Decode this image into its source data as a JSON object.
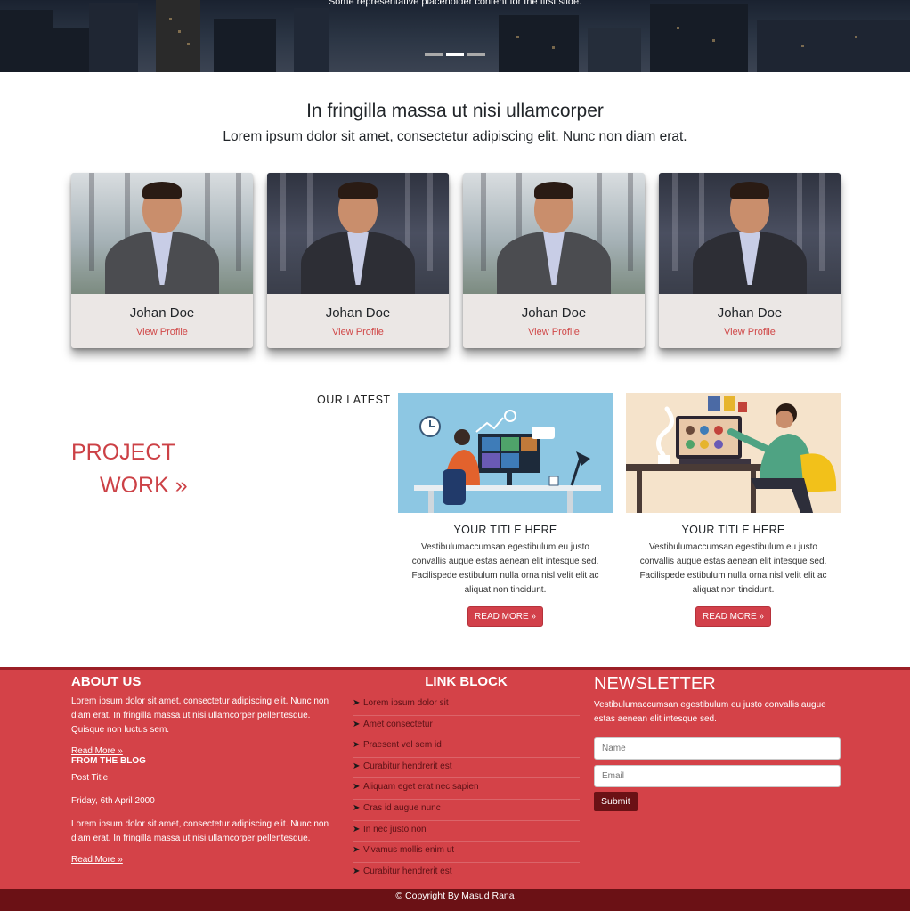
{
  "hero": {
    "caption": "Some representative placeholder content for the first slide.",
    "indicators": 3,
    "active_slide": 2
  },
  "intro": {
    "title": "In fringilla massa ut nisi ullamcorper",
    "subtitle": "Lorem ipsum dolor sit amet, consectetur adipiscing elit. Nunc non diam erat."
  },
  "team": [
    {
      "name": "Johan Doe",
      "link": "View Profile"
    },
    {
      "name": "Johan Doe",
      "link": "View Profile"
    },
    {
      "name": "Johan Doe",
      "link": "View Profile"
    },
    {
      "name": "Johan Doe",
      "link": "View Profile"
    }
  ],
  "projects": {
    "label": "OUR LATEST",
    "heading_line1": "PROJECT",
    "heading_line2": "WORK »",
    "cards": [
      {
        "title": "YOUR TITLE HERE",
        "text": "Vestibulumaccumsan egestibulum eu justo convallis augue estas aenean elit intesque sed. Facilispede estibulum nulla orna nisl velit elit ac aliquat non tincidunt.",
        "button": "READ MORE »"
      },
      {
        "title": "YOUR TITLE HERE",
        "text": "Vestibulumaccumsan egestibulum eu justo convallis augue estas aenean elit intesque sed. Facilispede estibulum nulla orna nisl velit elit ac aliquat non tincidunt.",
        "button": "READ MORE »"
      }
    ]
  },
  "footer": {
    "about": {
      "title": "ABOUT US",
      "text": "Lorem ipsum dolor sit amet, consectetur adipiscing elit. Nunc non diam erat. In fringilla massa ut nisi ullamcorper pellentesque. Quisque non luctus sem.",
      "read_more": "Read More »"
    },
    "blog": {
      "title": "FROM THE BLOG",
      "post_title": "Post Title",
      "date": "Friday, 6th April 2000",
      "text": "Lorem ipsum dolor sit amet, consectetur adipiscing elit. Nunc non diam erat. In fringilla massa ut nisi ullamcorper pellentesque.",
      "read_more": "Read More »"
    },
    "links": {
      "title": "LINK BLOCK",
      "items": [
        "Lorem ipsum dolor sit",
        "Amet consectetur",
        "Praesent vel sem id",
        "Curabitur hendrerit est",
        "Aliquam eget erat nec sapien",
        "Cras id augue nunc",
        "In nec justo non",
        "Vivamus mollis enim ut",
        "Curabitur hendrerit est"
      ]
    },
    "newsletter": {
      "title": "NEWSLETTER",
      "text": "Vestibulumaccumsan egestibulum eu justo convallis augue estas aenean elit intesque sed.",
      "name_placeholder": "Name",
      "email_placeholder": "Email",
      "submit": "Submit"
    },
    "copyright": "© Copyright By Masud Rana"
  },
  "colors": {
    "accent": "#d44248",
    "dark_accent": "#6b1115",
    "card_bg": "#ebe7e5",
    "link": "#d04848"
  },
  "icons": {
    "link_item": "paper-plane-icon"
  }
}
